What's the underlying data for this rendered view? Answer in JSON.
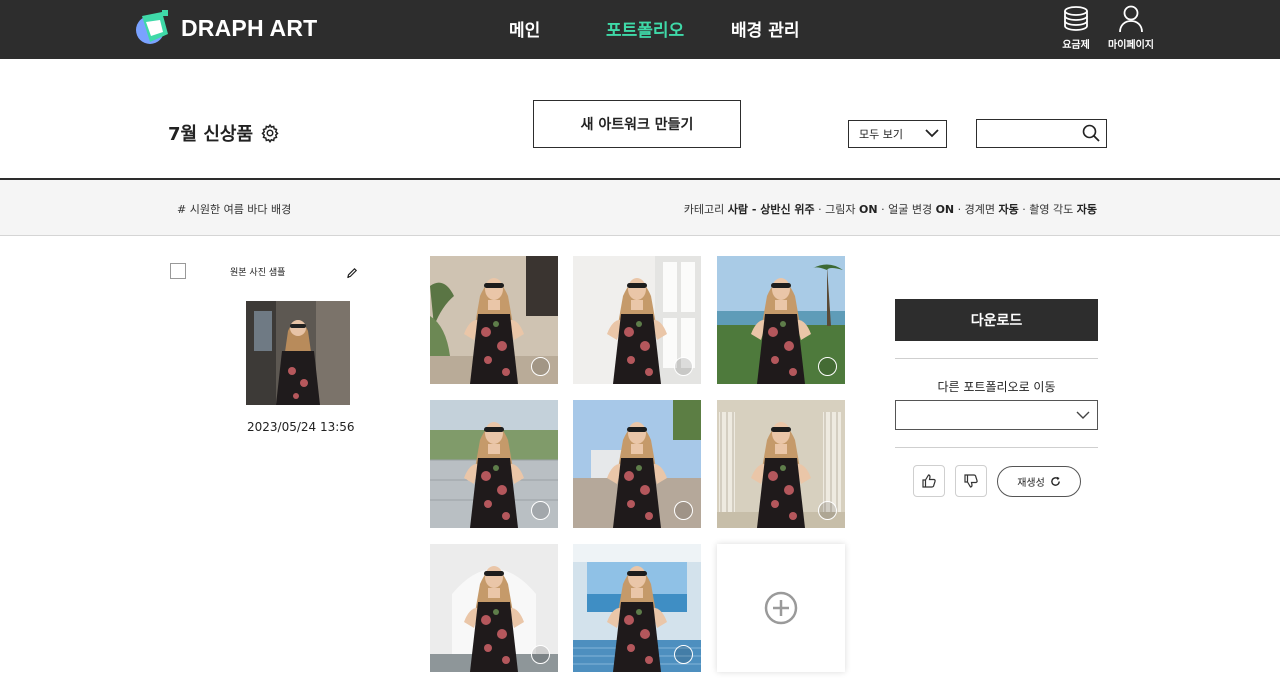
{
  "header": {
    "brand": "DRAPH ART",
    "nav": [
      {
        "label": "메인",
        "active": false
      },
      {
        "label": "포트폴리오",
        "active": true
      },
      {
        "label": "배경 관리",
        "active": false
      }
    ],
    "pricing_label": "요금제",
    "mypage_label": "마이페이지",
    "accent_color": "#3fd9a8",
    "bar_color": "#2d2d2d"
  },
  "toolbar": {
    "title": "7월 신상품",
    "new_artwork_label": "새 아트워크 만들기",
    "filter_value": "모두 보기",
    "search_value": ""
  },
  "info": {
    "tag": "# 시원한 여름 바다 배경",
    "options": [
      {
        "name": "카테고리",
        "value": "사람 - 상반신 위주"
      },
      {
        "name": "그림자",
        "value": "ON"
      },
      {
        "name": "얼굴 변경",
        "value": "ON"
      },
      {
        "name": "경계면",
        "value": "자동"
      },
      {
        "name": "촬영 각도",
        "value": "자동"
      }
    ]
  },
  "original": {
    "label": "원본 사진 샘플",
    "date": "2023/05/24 13:56"
  },
  "images": [
    {
      "name": "result-image-1",
      "scene": "room-plant"
    },
    {
      "name": "result-image-2",
      "scene": "white-window"
    },
    {
      "name": "result-image-3",
      "scene": "beach-palm"
    },
    {
      "name": "result-image-4",
      "scene": "fence-trees"
    },
    {
      "name": "result-image-5",
      "scene": "rooftop-deck"
    },
    {
      "name": "result-image-6",
      "scene": "classic-doors"
    },
    {
      "name": "result-image-7",
      "scene": "white-arch"
    },
    {
      "name": "result-image-8",
      "scene": "sea-pavilion"
    }
  ],
  "actions": {
    "download_label": "다운로드",
    "move_label": "다른 포트폴리오로 이동",
    "move_value": "",
    "regenerate_label": "재생성"
  }
}
